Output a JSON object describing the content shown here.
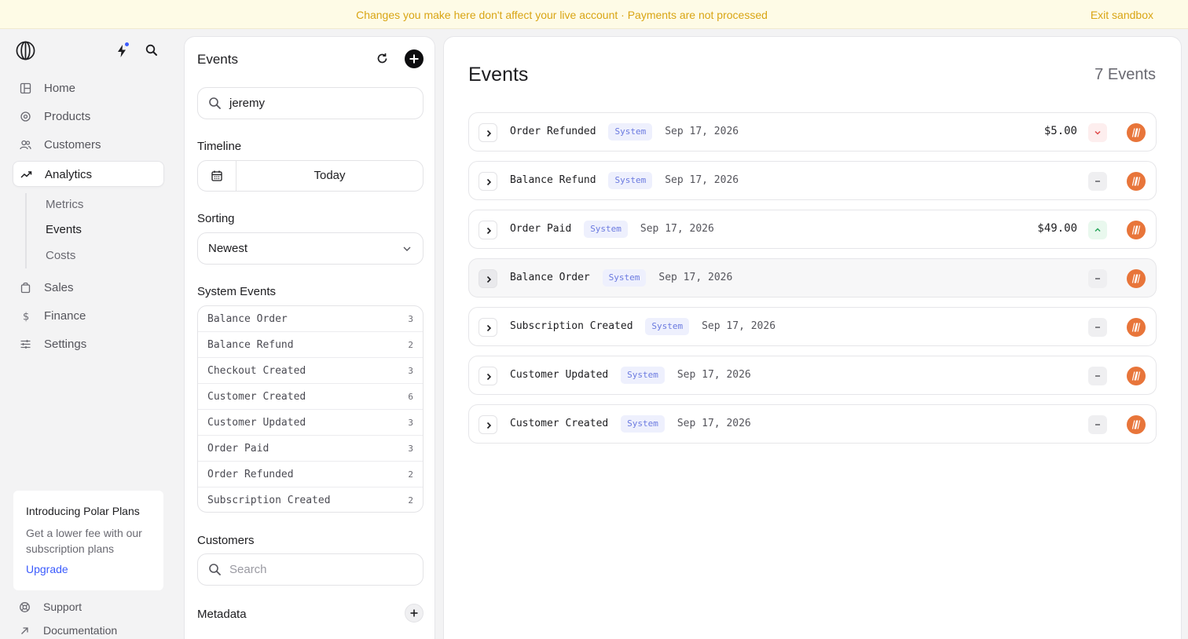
{
  "banner": {
    "message": "Changes you make here don't affect your live account · Payments are not processed",
    "exit_label": "Exit sandbox"
  },
  "sidebar": {
    "nav": [
      {
        "label": "Home",
        "icon": "home-icon"
      },
      {
        "label": "Products",
        "icon": "products-icon"
      },
      {
        "label": "Customers",
        "icon": "customers-icon"
      },
      {
        "label": "Analytics",
        "icon": "analytics-icon",
        "active": true
      },
      {
        "label": "Sales",
        "icon": "sales-icon"
      },
      {
        "label": "Finance",
        "icon": "finance-icon"
      },
      {
        "label": "Settings",
        "icon": "settings-icon"
      }
    ],
    "analytics_sub": [
      {
        "label": "Metrics"
      },
      {
        "label": "Events",
        "active": true
      },
      {
        "label": "Costs"
      }
    ],
    "promo": {
      "title": "Introducing Polar Plans",
      "body": "Get a lower fee with our subscription plans",
      "link": "Upgrade"
    },
    "footer": [
      {
        "label": "Support",
        "icon": "support-icon"
      },
      {
        "label": "Documentation",
        "icon": "external-link-icon"
      }
    ]
  },
  "filters": {
    "title": "Events",
    "search_value": "jeremy",
    "timeline_label": "Timeline",
    "timeline_value": "Today",
    "sorting_label": "Sorting",
    "sorting_value": "Newest",
    "system_events_label": "System Events",
    "system_events": [
      {
        "name": "Balance Order",
        "count": "3"
      },
      {
        "name": "Balance Refund",
        "count": "2"
      },
      {
        "name": "Checkout Created",
        "count": "3"
      },
      {
        "name": "Customer Created",
        "count": "6"
      },
      {
        "name": "Customer Updated",
        "count": "3"
      },
      {
        "name": "Order Paid",
        "count": "3"
      },
      {
        "name": "Order Refunded",
        "count": "2"
      },
      {
        "name": "Subscription Created",
        "count": "2"
      }
    ],
    "customers_label": "Customers",
    "customers_placeholder": "Search",
    "metadata_label": "Metadata"
  },
  "main": {
    "title": "Events",
    "count": "7 Events",
    "events": [
      {
        "name": "Order Refunded",
        "tag": "System",
        "date": "Sep 17, 2026",
        "amount": "$5.00",
        "direction": "down"
      },
      {
        "name": "Balance Refund",
        "tag": "System",
        "date": "Sep 17, 2026",
        "amount": "",
        "direction": "none"
      },
      {
        "name": "Order Paid",
        "tag": "System",
        "date": "Sep 17, 2026",
        "amount": "$49.00",
        "direction": "up"
      },
      {
        "name": "Balance Order",
        "tag": "System",
        "date": "Sep 17, 2026",
        "amount": "",
        "direction": "none"
      },
      {
        "name": "Subscription Created",
        "tag": "System",
        "date": "Sep 17, 2026",
        "amount": "",
        "direction": "none"
      },
      {
        "name": "Customer Updated",
        "tag": "System",
        "date": "Sep 17, 2026",
        "amount": "",
        "direction": "none"
      },
      {
        "name": "Customer Created",
        "tag": "System",
        "date": "Sep 17, 2026",
        "amount": "",
        "direction": "none"
      }
    ]
  },
  "colors": {
    "banner_text": "#d9a514",
    "accent": "#3b5bfd",
    "avatar": "#e8753a",
    "tag_bg": "#eef0fd",
    "tag_text": "#6b7ae0"
  }
}
